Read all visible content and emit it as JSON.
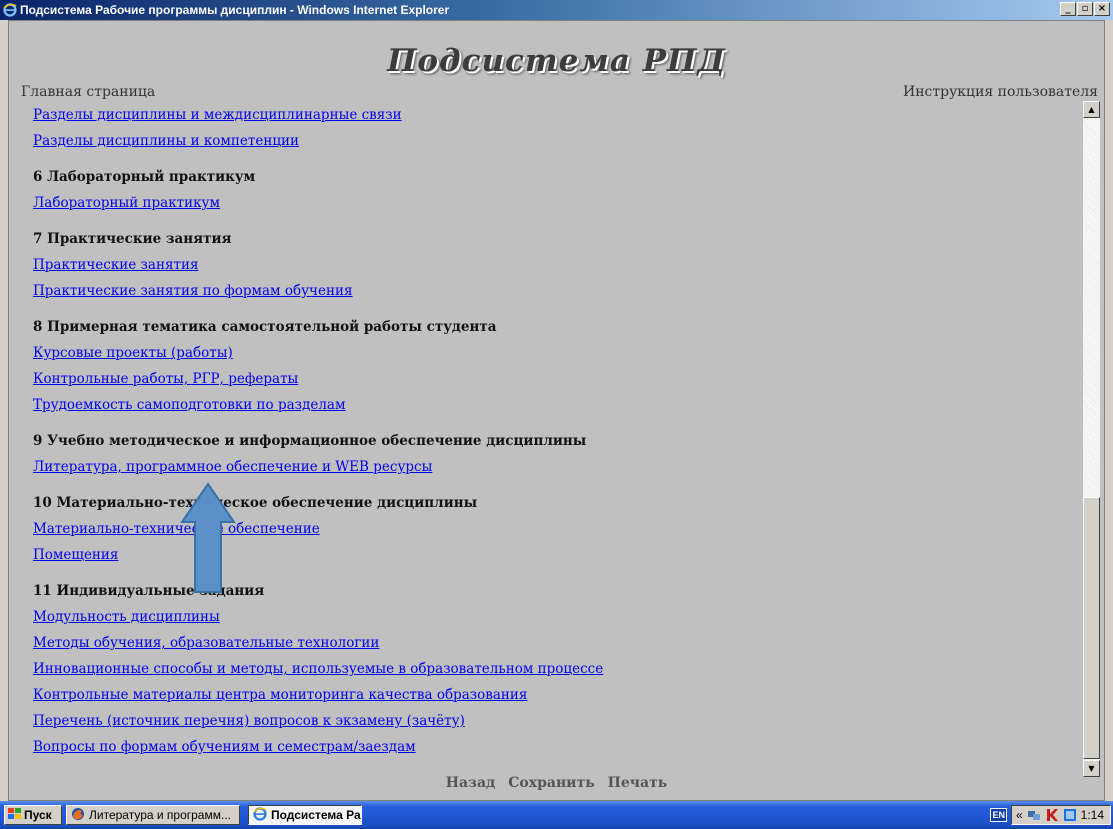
{
  "window": {
    "title": "Подсистема Рабочие программы дисциплин - Windows Internet Explorer",
    "minimize": "_",
    "maximize": "▫",
    "close": "×"
  },
  "page": {
    "title": "Подсистема РПД",
    "home_link": "Главная страница",
    "help_link": "Инструкция пользователя"
  },
  "items": [
    {
      "type": "link",
      "text": "Разделы дисциплины и междисциплинарные связи"
    },
    {
      "type": "link",
      "text": "Разделы дисциплины и компетенции"
    },
    {
      "type": "heading",
      "text": "6 Лабораторный практикум"
    },
    {
      "type": "link",
      "text": "Лабораторный практикум"
    },
    {
      "type": "heading",
      "text": "7 Практические занятия"
    },
    {
      "type": "link",
      "text": "Практические занятия"
    },
    {
      "type": "link",
      "text": "Практические занятия по формам обучения"
    },
    {
      "type": "heading",
      "text": "8 Примерная тематика самостоятельной работы студента"
    },
    {
      "type": "link",
      "text": "Курсовые проекты (работы)"
    },
    {
      "type": "link",
      "text": "Контрольные работы, РГР, рефераты"
    },
    {
      "type": "link",
      "text": "Трудоемкость самоподготовки по разделам"
    },
    {
      "type": "heading",
      "text": "9 Учебно методическое и информационное обеспечение дисциплины"
    },
    {
      "type": "link",
      "text": "Литература, программное обеспечение и WEB ресурсы"
    },
    {
      "type": "heading",
      "text": "10 Материально-техническое обеспечение дисциплины"
    },
    {
      "type": "link",
      "text": "Материально-техническое обеспечение"
    },
    {
      "type": "link",
      "text": "Помещения"
    },
    {
      "type": "heading",
      "text": "11 Индивидуальные задания"
    },
    {
      "type": "link",
      "text": "Модульность дисциплины"
    },
    {
      "type": "link",
      "text": "Методы обучения, образовательные технологии"
    },
    {
      "type": "link",
      "text": "Инновационные способы и методы, используемые в образовательном процессе"
    },
    {
      "type": "link",
      "text": "Контрольные материалы центра мониторинга качества образования"
    },
    {
      "type": "link",
      "text": "Перечень (источник перечня) вопросов к экзамену (зачёту)"
    },
    {
      "type": "link",
      "text": "Вопросы по формам обучениям и семестрам/заездам"
    }
  ],
  "bottom": {
    "back": "Назад",
    "save": "Сохранить",
    "print": "Печать"
  },
  "taskbar": {
    "start": "Пуск",
    "tasks": [
      {
        "label": "Литература и программ..."
      },
      {
        "label": "Подсистема Рабочие..."
      }
    ],
    "lang": "EN",
    "chevron": "«",
    "time": "1:14"
  },
  "colors": {
    "link": "#0000ee",
    "arrow": "#5b8fc7",
    "arrow_border": "#3a6fa8"
  }
}
